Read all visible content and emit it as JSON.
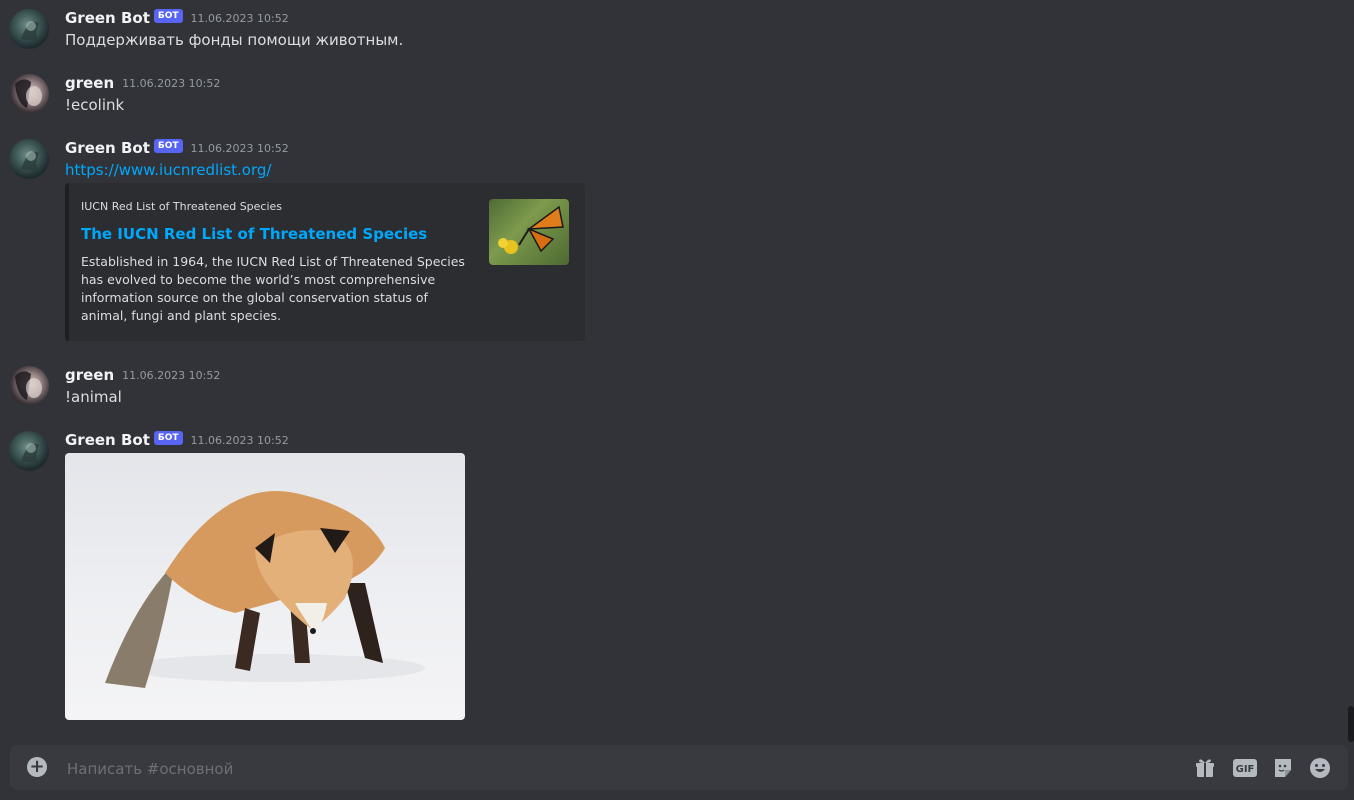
{
  "messages": [
    {
      "author": "Green Bot",
      "badge": "БОТ",
      "time": "11.06.2023 10:52",
      "text": "Поддерживать фонды помощи животным."
    },
    {
      "author": "green",
      "time": "11.06.2023 10:52",
      "text": "!ecolink"
    },
    {
      "author": "Green Bot",
      "badge": "БОТ",
      "time": "11.06.2023 10:52",
      "link": "https://www.iucnredlist.org/",
      "embed": {
        "provider": "IUCN Red List of Threatened Species",
        "title": "The IUCN Red List of Threatened Species",
        "description": "Established in 1964, the IUCN Red List of Threatened Species has evolved to become the world’s most comprehensive information source on the global conservation status of animal, fungi and plant species."
      }
    },
    {
      "author": "green",
      "time": "11.06.2023 10:52",
      "text": "!animal"
    },
    {
      "author": "Green Bot",
      "badge": "БОТ",
      "time": "11.06.2023 10:52"
    }
  ],
  "composer": {
    "placeholder": "Написать #основной",
    "gif_label": "GIF"
  },
  "colors": {
    "background": "#313338",
    "link": "#00a8fc",
    "badge": "#5865f2",
    "embed_bg": "#2b2d31"
  },
  "icons": [
    "plus-circle-icon",
    "gift-icon",
    "gif-icon",
    "sticker-icon",
    "emoji-icon"
  ]
}
